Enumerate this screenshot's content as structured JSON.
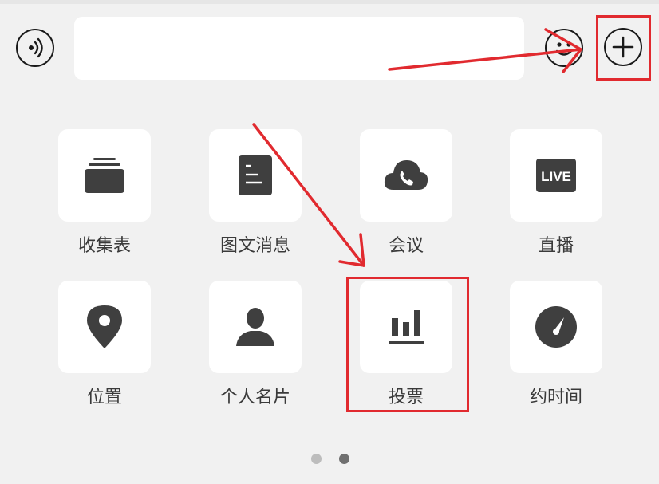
{
  "input_bar": {
    "voice_icon": "voice-input-icon",
    "emoji_icon": "emoji-icon",
    "plus_icon": "plus-circle-icon",
    "text_value": ""
  },
  "panel": {
    "items": [
      {
        "label": "收集表",
        "icon": "stack-folder-icon"
      },
      {
        "label": "图文消息",
        "icon": "document-icon"
      },
      {
        "label": "会议",
        "icon": "cloud-phone-icon"
      },
      {
        "label": "直播",
        "icon": "live-icon",
        "icon_text": "LIVE"
      },
      {
        "label": "位置",
        "icon": "location-pin-icon"
      },
      {
        "label": "个人名片",
        "icon": "person-icon"
      },
      {
        "label": "投票",
        "icon": "bar-chart-icon"
      },
      {
        "label": "约时间",
        "icon": "gauge-icon"
      }
    ],
    "pager": {
      "pages": 2,
      "current_page": 2
    }
  },
  "colors": {
    "background": "#f1f1f1",
    "tile": "#ffffff",
    "icon": "#3f3f3f",
    "label": "#3a3a3a",
    "annotation": "#e12a2f",
    "dot_inactive": "#bdbdbd",
    "dot_active": "#707070"
  }
}
